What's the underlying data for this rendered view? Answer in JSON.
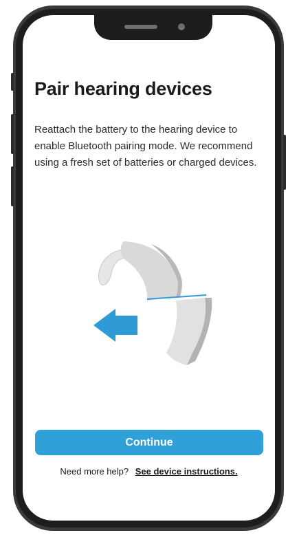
{
  "screen": {
    "title": "Pair hearing devices",
    "description": "Reattach the battery to the hearing device to enable Bluetooth pairing mode. We recommend using a fresh set of batteries or charged devices."
  },
  "illustration": {
    "icon": "hearing-device-battery-illustration",
    "arrow_color": "#2e9bd6",
    "device_color": "#d9d9d9"
  },
  "actions": {
    "continue_label": "Continue",
    "help_prefix": "Need more help?",
    "help_link": "See device instructions."
  },
  "colors": {
    "accent": "#2fa0d8",
    "frame": "#1d1d1d"
  }
}
